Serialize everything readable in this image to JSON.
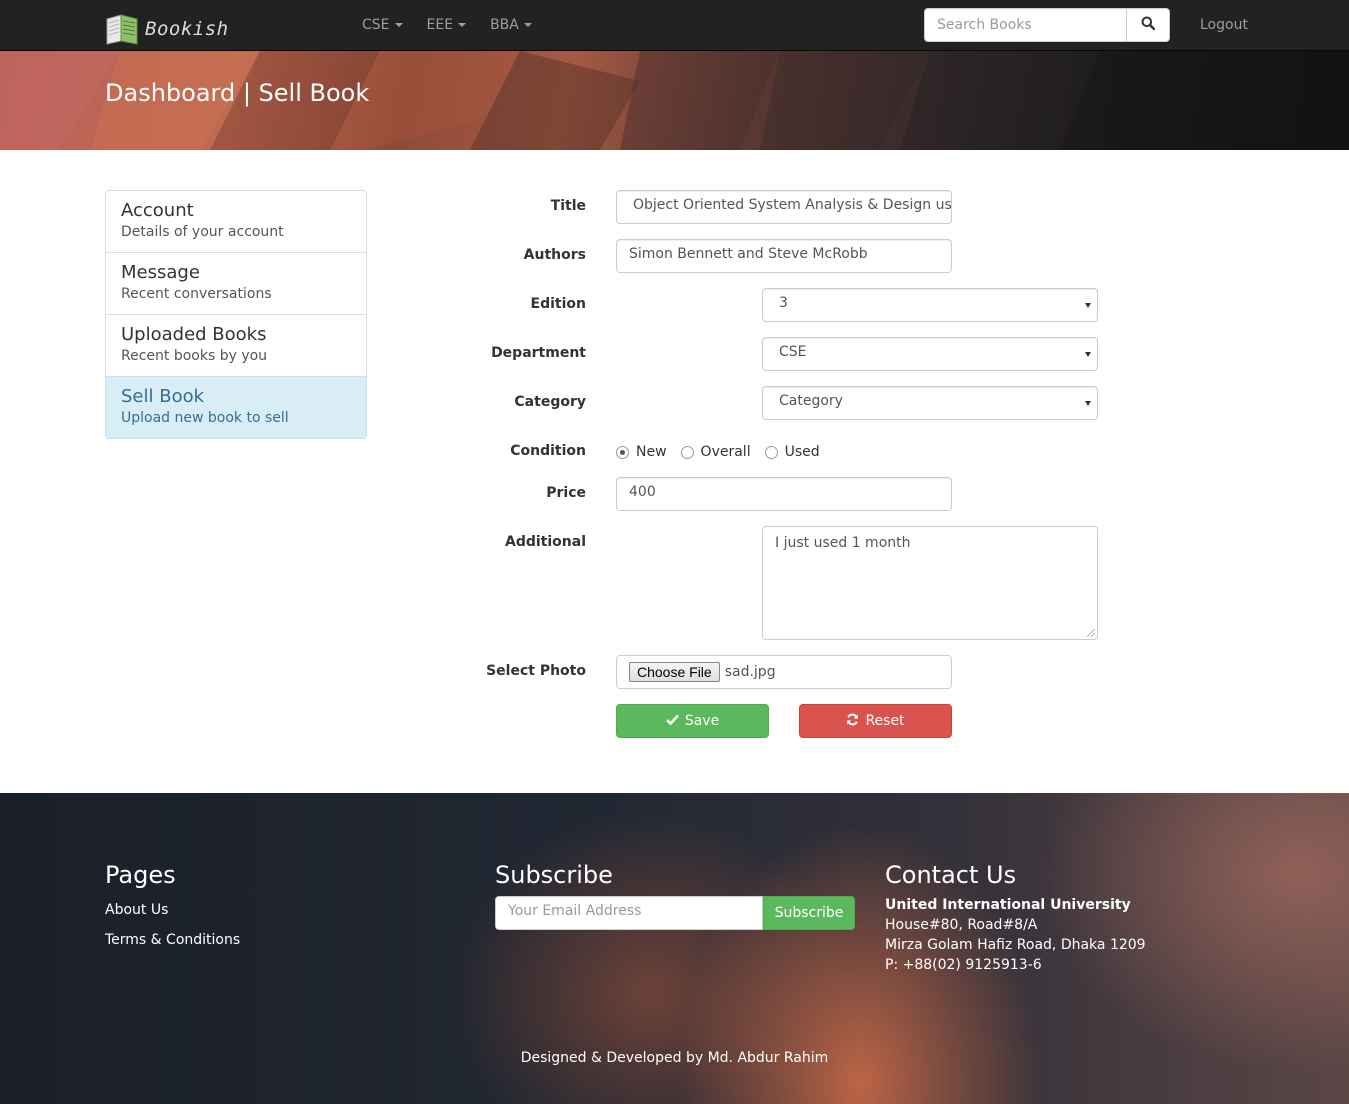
{
  "navbar": {
    "brand": "Bookish",
    "menus": [
      {
        "label": "CSE"
      },
      {
        "label": "EEE"
      },
      {
        "label": "BBA"
      }
    ],
    "search_placeholder": "Search Books",
    "logout": "Logout"
  },
  "banner": {
    "title": "Dashboard | Sell Book"
  },
  "sidebar": {
    "items": [
      {
        "title": "Account",
        "subtitle": "Details of your account"
      },
      {
        "title": "Message",
        "subtitle": "Recent conversations"
      },
      {
        "title": "Uploaded Books",
        "subtitle": "Recent books by you"
      },
      {
        "title": "Sell Book",
        "subtitle": "Upload new book to sell"
      }
    ]
  },
  "form": {
    "title_label": "Title",
    "title_value": "Object Oriented System Analysis & Design usi",
    "authors_label": "Authors",
    "authors_value": "Simon Bennett and Steve McRobb",
    "edition_label": "Edition",
    "edition_value": "3",
    "department_label": "Department",
    "department_value": "CSE",
    "category_label": "Category",
    "category_value": "Category",
    "condition_label": "Condition",
    "conditions": [
      "New",
      "Overall",
      "Used"
    ],
    "condition_selected": "New",
    "price_label": "Price",
    "price_value": "400",
    "additional_label": "Additional",
    "additional_value": "I just used 1 month",
    "photo_label": "Select Photo",
    "choose_file": "Choose File",
    "file_name": "sad.jpg",
    "save": "Save",
    "reset": "Reset"
  },
  "footer": {
    "pages_heading": "Pages",
    "pages_links": [
      "About Us",
      "Terms & Conditions"
    ],
    "subscribe_heading": "Subscribe",
    "email_placeholder": "Your Email Address",
    "subscribe_button": "Subscribe",
    "contact_heading": "Contact Us",
    "contact_org": "United International University",
    "contact_lines": [
      "House#80, Road#8/A",
      "Mirza Golam Hafiz Road, Dhaka 1209",
      "P: +88(02) 9125913-6"
    ],
    "credit": "Designed & Developed by Md. Abdur Rahim"
  },
  "colors": {
    "navbar_bg": "#222222",
    "active_bg": "#d9edf7",
    "active_text": "#31708f",
    "success": "#5cb85c",
    "danger": "#d9534f"
  },
  "icons": {
    "brand": "book-logo-icon",
    "search": "search-icon",
    "save": "check-icon",
    "reset": "refresh-icon"
  }
}
